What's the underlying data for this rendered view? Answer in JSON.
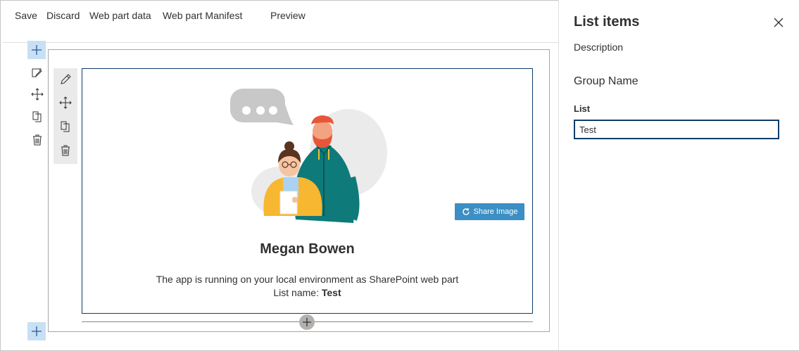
{
  "toolbar": {
    "save": "Save",
    "discard": "Discard",
    "web_part_data": "Web part data",
    "web_part_manifest": "Web part Manifest",
    "preview": "Preview"
  },
  "webpart": {
    "share_image_label": "Share Image",
    "person_name": "Megan Bowen",
    "description": "The app is running on your local environment as SharePoint web part",
    "list_name_label": "List name:",
    "list_name_value": "Test"
  },
  "panel": {
    "title": "List items",
    "description": "Description",
    "group_name": "Group Name",
    "list_label": "List",
    "list_value": "Test"
  },
  "colors": {
    "accent": "#0f3c6b",
    "add_button_bg": "#c7e0f4",
    "share_button_bg": "#3b8fc4"
  },
  "icons": [
    "add-icon",
    "edit-icon",
    "move-icon",
    "duplicate-icon",
    "delete-icon",
    "refresh-icon",
    "close-icon"
  ]
}
